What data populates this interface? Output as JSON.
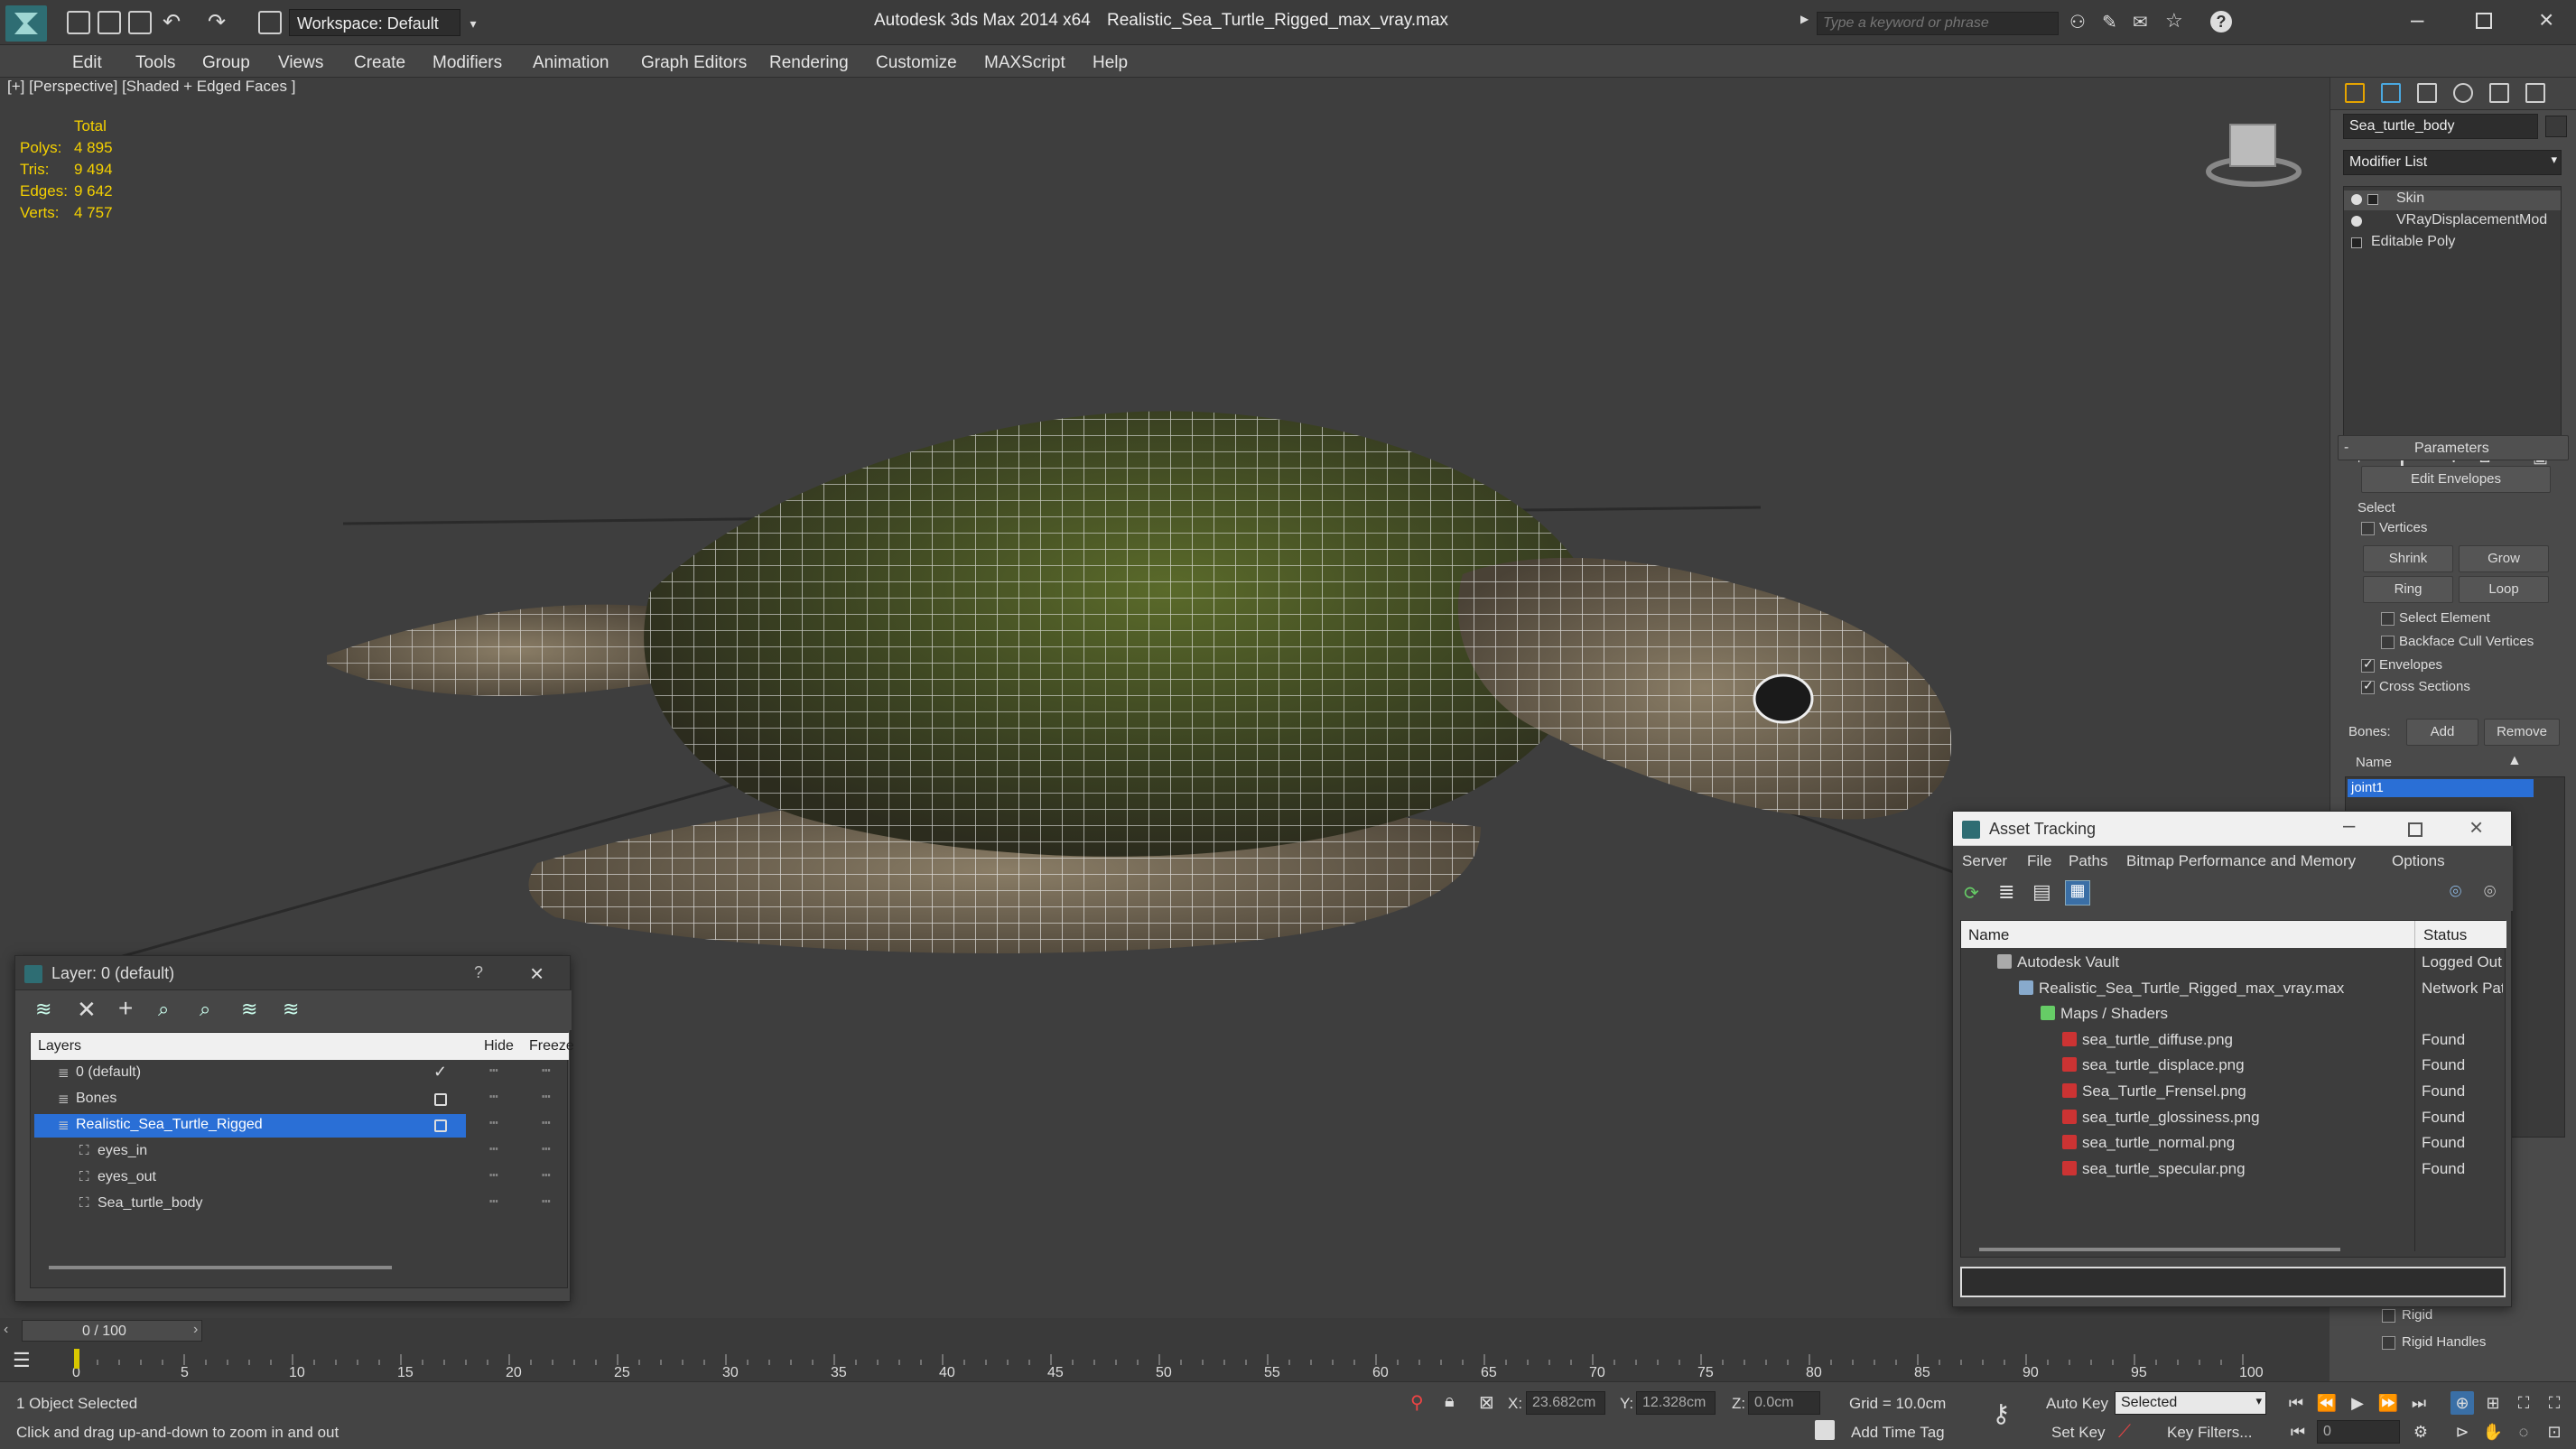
{
  "titlebar": {
    "app_title": "Autodesk 3ds Max  2014 x64",
    "file_title": "Realistic_Sea_Turtle_Rigged_max_vray.max",
    "workspace": "Workspace: Default",
    "search_placeholder": "Type a keyword or phrase"
  },
  "menu": [
    "Edit",
    "Tools",
    "Group",
    "Views",
    "Create",
    "Modifiers",
    "Animation",
    "Graph Editors",
    "Rendering",
    "Customize",
    "MAXScript",
    "Help"
  ],
  "viewport": {
    "label": "[+] [Perspective] [Shaded + Edged Faces ]",
    "stats": {
      "header": "Total",
      "rows": [
        {
          "label": "Polys:",
          "value": "4 895"
        },
        {
          "label": "Tris:",
          "value": "9 494"
        },
        {
          "label": "Edges:",
          "value": "9 642"
        },
        {
          "label": "Verts:",
          "value": "4 757"
        }
      ]
    }
  },
  "command_panel": {
    "object_name": "Sea_turtle_body",
    "modifier_list": "Modifier List",
    "stack": [
      "Skin",
      "VRayDisplacementMod",
      "Editable Poly"
    ],
    "rollout_title": "Parameters",
    "edit_envelopes": "Edit Envelopes",
    "select_label": "Select",
    "vertices": "Vertices",
    "shrink": "Shrink",
    "grow": "Grow",
    "ring": "Ring",
    "loop": "Loop",
    "select_element": "Select Element",
    "backface_cull": "Backface Cull Vertices",
    "envelopes": "Envelopes",
    "cross_sections": "Cross Sections",
    "bones_label": "Bones:",
    "add": "Add",
    "remove": "Remove",
    "name_header": "Name",
    "bones_list": [
      "joint1"
    ],
    "rigid": "Rigid",
    "rigid_handles": "Rigid Handles"
  },
  "layer_dialog": {
    "title": "Layer: 0 (default)",
    "help": "?",
    "columns": {
      "layers": "Layers",
      "hide": "Hide",
      "freeze": "Freeze"
    },
    "rows": [
      {
        "name": "0 (default)",
        "indent": 0,
        "current": true
      },
      {
        "name": "Bones",
        "indent": 0
      },
      {
        "name": "Realistic_Sea_Turtle_Rigged",
        "indent": 0,
        "selected": true
      },
      {
        "name": "eyes_in",
        "indent": 1
      },
      {
        "name": "eyes_out",
        "indent": 1
      },
      {
        "name": "Sea_turtle_body",
        "indent": 1
      }
    ]
  },
  "asset_dialog": {
    "title": "Asset Tracking",
    "menu": [
      "Server",
      "File",
      "Paths",
      "Bitmap Performance and Memory",
      "Options"
    ],
    "columns": {
      "name": "Name",
      "status": "Status"
    },
    "rows": [
      {
        "name": "Autodesk Vault",
        "status": "Logged Out",
        "indent": 0,
        "type": "vault"
      },
      {
        "name": "Realistic_Sea_Turtle_Rigged_max_vray.max",
        "status": "Network Path",
        "indent": 1,
        "type": "max"
      },
      {
        "name": "Maps / Shaders",
        "status": "",
        "indent": 2,
        "type": "maps"
      },
      {
        "name": "sea_turtle_diffuse.png",
        "status": "Found",
        "indent": 3,
        "type": "png"
      },
      {
        "name": "sea_turtle_displace.png",
        "status": "Found",
        "indent": 3,
        "type": "png"
      },
      {
        "name": "Sea_Turtle_Frensel.png",
        "status": "Found",
        "indent": 3,
        "type": "png"
      },
      {
        "name": "sea_turtle_glossiness.png",
        "status": "Found",
        "indent": 3,
        "type": "png"
      },
      {
        "name": "sea_turtle_normal.png",
        "status": "Found",
        "indent": 3,
        "type": "png"
      },
      {
        "name": "sea_turtle_specular.png",
        "status": "Found",
        "indent": 3,
        "type": "png"
      }
    ]
  },
  "timeline": {
    "frame": "0 / 100",
    "ticks": [
      "0",
      "5",
      "10",
      "15",
      "20",
      "25",
      "30",
      "35",
      "40",
      "45",
      "50",
      "55",
      "60",
      "65",
      "70",
      "75",
      "80",
      "85",
      "90",
      "95",
      "100"
    ]
  },
  "status": {
    "selection": "1 Object Selected",
    "prompt": "Click and drag up-and-down to zoom in and out",
    "x_label": "X:",
    "x_value": "23.682cm",
    "y_label": "Y:",
    "y_value": "12.328cm",
    "z_label": "Z:",
    "z_value": "0.0cm",
    "grid": "Grid = 10.0cm",
    "add_time_tag": "Add Time Tag",
    "auto_key": "Auto Key",
    "set_key": "Set Key",
    "key_mode": "Selected",
    "key_filters": "Key Filters...",
    "current_frame": "0"
  }
}
